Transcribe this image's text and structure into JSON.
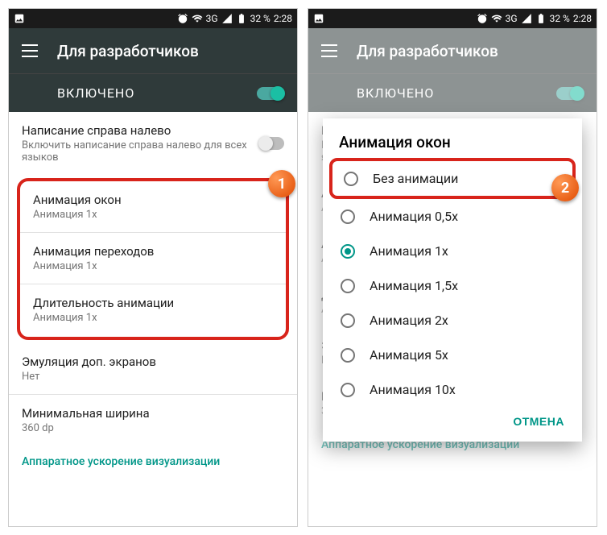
{
  "statusbar": {
    "network": "3G",
    "battery": "32 %",
    "time": "2:28"
  },
  "appbar": {
    "title": "Для разработчиков"
  },
  "masterToggle": {
    "label": "ВКЛЮЧЕНО"
  },
  "left": {
    "rtl": {
      "title": "Написание справа налево",
      "sub": "Включить написание справа налево для всех языков"
    },
    "items": [
      {
        "title": "Анимация окон",
        "sub": "Анимация 1x"
      },
      {
        "title": "Анимация переходов",
        "sub": "Анимация 1x"
      },
      {
        "title": "Длительность анимации",
        "sub": "Анимация 1x"
      }
    ],
    "emu": {
      "title": "Эмуляция доп. экранов",
      "sub": "Нет"
    },
    "minw": {
      "title": "Минимальная ширина",
      "sub": "360 dp"
    },
    "section": "Аппаратное ускорение визуализации"
  },
  "dialog": {
    "title": "Анимация окон",
    "options": [
      "Без анимации",
      "Анимация 0,5x",
      "Анимация 1x",
      "Анимация 1,5x",
      "Анимация 2x",
      "Анимация 5x",
      "Анимация 10x"
    ],
    "selectedIndex": 2,
    "cancel": "ОТМЕНА"
  },
  "badges": {
    "one": "1",
    "two": "2"
  }
}
